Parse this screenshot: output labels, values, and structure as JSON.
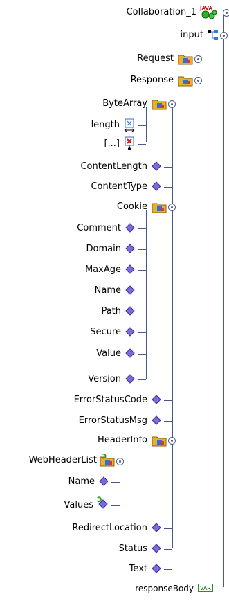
{
  "tree": {
    "nodes": [
      {
        "key": "collab",
        "label": "Collaboration_1",
        "icon": "java-collaboration-icon"
      },
      {
        "key": "input",
        "label": "input",
        "icon": "input-node-icon"
      },
      {
        "key": "request",
        "label": "Request",
        "icon": "folder-class-icon"
      },
      {
        "key": "response",
        "label": "Response",
        "icon": "folder-class-icon"
      },
      {
        "key": "bytearray",
        "label": "ByteArray",
        "icon": "folder-class-icon"
      },
      {
        "key": "length",
        "label": "length",
        "icon": "array-length-icon"
      },
      {
        "key": "ellipsis",
        "label": "[...]",
        "icon": "array-element-icon"
      },
      {
        "key": "contentlength",
        "label": "ContentLength",
        "icon": "diamond-field-icon"
      },
      {
        "key": "contenttype",
        "label": "ContentType",
        "icon": "diamond-field-icon"
      },
      {
        "key": "cookie",
        "label": "Cookie",
        "icon": "folder-class-icon"
      },
      {
        "key": "comment",
        "label": "Comment",
        "icon": "diamond-field-icon"
      },
      {
        "key": "domain",
        "label": "Domain",
        "icon": "diamond-field-icon"
      },
      {
        "key": "maxage",
        "label": "MaxAge",
        "icon": "diamond-field-icon"
      },
      {
        "key": "name1",
        "label": "Name",
        "icon": "diamond-field-icon"
      },
      {
        "key": "path",
        "label": "Path",
        "icon": "diamond-field-icon"
      },
      {
        "key": "secure",
        "label": "Secure",
        "icon": "diamond-field-icon"
      },
      {
        "key": "value",
        "label": "Value",
        "icon": "diamond-field-icon"
      },
      {
        "key": "version",
        "label": "Version",
        "icon": "diamond-field-icon"
      },
      {
        "key": "errstatuscode",
        "label": "ErrorStatusCode",
        "icon": "diamond-field-icon"
      },
      {
        "key": "errstatusmsg",
        "label": "ErrorStatusMsg",
        "icon": "diamond-field-icon"
      },
      {
        "key": "headerinfo",
        "label": "HeaderInfo",
        "icon": "folder-class-icon"
      },
      {
        "key": "webheaderlist",
        "label": "WebHeaderList",
        "icon": "folder-list-icon"
      },
      {
        "key": "name2",
        "label": "Name",
        "icon": "diamond-field-icon"
      },
      {
        "key": "values",
        "label": "Values",
        "icon": "diamond-repeating-icon"
      },
      {
        "key": "redirect",
        "label": "RedirectLocation",
        "icon": "diamond-field-icon"
      },
      {
        "key": "status",
        "label": "Status",
        "icon": "diamond-field-icon"
      },
      {
        "key": "text",
        "label": "Text",
        "icon": "diamond-field-icon"
      },
      {
        "key": "responsebody",
        "label": "responseBody",
        "icon": "var-icon",
        "icon_text": "VAR"
      }
    ]
  },
  "icons": {
    "java_badge_text": "JAVA"
  },
  "colors": {
    "connector": "#4a5a8a",
    "diamond": "#7b6cd9",
    "folder": "#e8b030",
    "accent_blue": "#1f5fb8"
  }
}
